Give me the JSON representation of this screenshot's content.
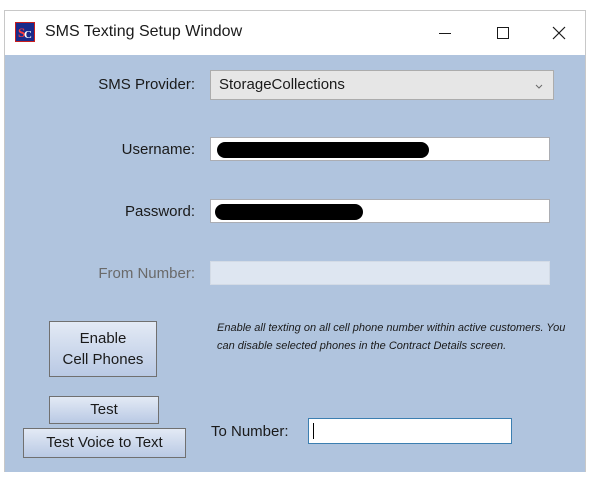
{
  "window": {
    "title": "SMS Texting Setup Window",
    "icon": "sc-app-icon",
    "controls": [
      "minimize-icon",
      "maximize-icon",
      "close-icon"
    ]
  },
  "form": {
    "sms_provider": {
      "label": "SMS Provider:",
      "value": "StorageCollections"
    },
    "username": {
      "label": "Username:",
      "value": ""
    },
    "password": {
      "label": "Password:",
      "value": ""
    },
    "from_number": {
      "label": "From Number:",
      "value": ""
    }
  },
  "buttons": {
    "enable_cell_phones": {
      "line1": "Enable",
      "line2": "Cell Phones"
    },
    "test": "Test",
    "test_voice": "Test Voice to Text"
  },
  "note": "Enable all texting on all cell phone number within active customers. You can disable selected phones in the Contract Details screen.",
  "to_number": {
    "label": "To Number:",
    "value": ""
  },
  "colors": {
    "client_background": "#b0c4de",
    "button_gradient_top": "#e3eaf5",
    "button_gradient_bottom": "#b9c9e4",
    "disabled_field": "#dee6f1"
  }
}
